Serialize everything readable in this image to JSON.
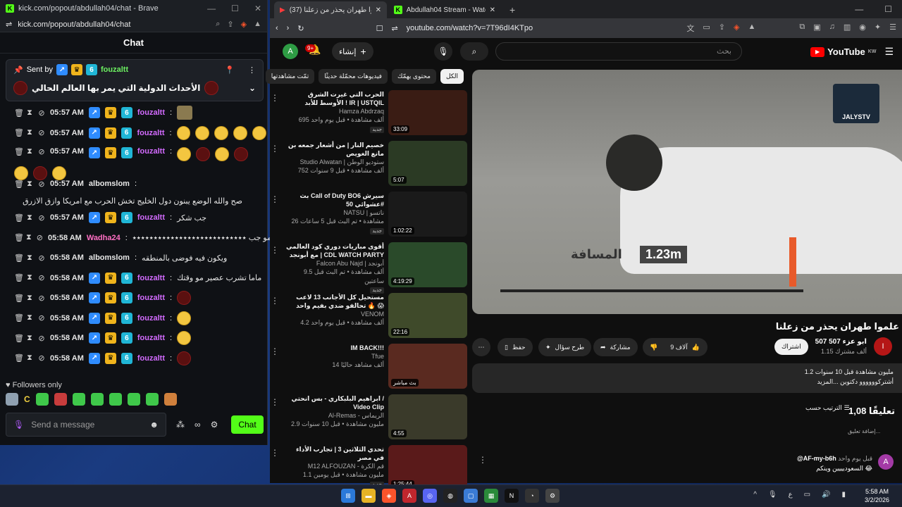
{
  "kick": {
    "window_title": "kick.com/popout/abdullah04/chat - Brave",
    "url": "kick.com/popout/abdullah04/chat",
    "chat_header": "Chat",
    "pinned": {
      "sent_by_label": "Sent by",
      "user": "fouzaltt",
      "message": "الأحداث الدولية التي يمر بها العالم الحالي"
    },
    "messages": [
      {
        "time": "05:57 AM",
        "user": "fouzaltt",
        "text": "",
        "emotes": 1
      },
      {
        "time": "05:57 AM",
        "user": "fouzaltt",
        "text": "",
        "emotes": 5
      },
      {
        "time": "05:57 AM",
        "user": "fouzaltt",
        "text": "",
        "emotes": 7
      },
      {
        "time": "05:57 AM",
        "user": "albomslom",
        "text": "صح والله الوضع يبنون دول الخليج تخش الحرب مع امريكا وازق الازرق"
      },
      {
        "time": "05:57 AM",
        "user": "fouzaltt",
        "text": "جب شكر"
      },
      {
        "time": "05:58 AM",
        "user": "Wadha24",
        "text": "مو جب ٭٭٭٭٭٭٭٭٭٭٭٭٭٭٭٭٭٭٭٭٭٭٭٭٭٭٭"
      },
      {
        "time": "05:58 AM",
        "user": "albomslom",
        "text": "ويكون فيه فوضى بالمنطقه"
      },
      {
        "time": "05:58 AM",
        "user": "fouzaltt",
        "text": "ماما تشرب عصير مو وقتك"
      },
      {
        "time": "05:58 AM",
        "user": "fouzaltt",
        "text": "",
        "emotes": 1
      },
      {
        "time": "05:58 AM",
        "user": "fouzaltt",
        "text": "",
        "emotes": 1
      },
      {
        "time": "05:58 AM",
        "user": "fouzaltt",
        "text": "",
        "emotes": 1
      },
      {
        "time": "05:58 AM",
        "user": "fouzaltt",
        "text": "",
        "emotes": 1
      }
    ],
    "followers_only": "Followers only",
    "input_placeholder": "Send a message",
    "send_label": "Chat"
  },
  "browser": {
    "tabs": [
      {
        "label": "(37) علموا طهران يحذر من زعلنا -"
      },
      {
        "label": "Abdullah04 Stream - Watch Live on K"
      }
    ],
    "url": "youtube.com/watch?v=7T96dI4KTpo"
  },
  "youtube": {
    "logo": "YouTube",
    "region": "KW",
    "search_placeholder": "بحث",
    "create_label": "إنشاء",
    "notifications": "9+",
    "avatar_letter": "A",
    "chips": [
      "الكل",
      "محتوى يهمّك",
      "فيديوهات محمّلة حديثًا",
      "تمّت مشاهدتها"
    ],
    "recs": [
      {
        "title": "الحرب التي غيرت الشرق الأوسط للأبد ! IR | USTQIL",
        "channel": "Hamza Abdrzaq",
        "stats": "695 ألف مشاهدة • قبل يوم واحد",
        "badge": "جديد",
        "duration": "33:09",
        "color": "#3a1c14"
      },
      {
        "title": "خصيم النار | من أشعار جمعه بن مانع الغويص",
        "channel": "Studio Alwatan | ستوديو الوطن",
        "stats": "752 ألف مشاهدة • قبل 9 سنوات",
        "badge": "",
        "duration": "5:07",
        "color": "#2b3a24"
      },
      {
        "title": "بث Call of Duty BO6 سيرش عشوائي 50#",
        "channel": "NATSU | ناتسو",
        "stats": "26 مشاهدة • تم البث قبل 5 ساعات",
        "badge": "جديد",
        "duration": "1:02:22",
        "color": "#1a1a1a"
      },
      {
        "title": "أقوى مباريات دوري كود العالمي مع أبونجد | CDL WATCH PARTY",
        "channel": "Falcon Abu Najd | أبونجد",
        "stats": "9.5 ألف مشاهدة • تم البث قبل ساعتين",
        "badge": "جديد",
        "duration": "4:19:29",
        "color": "#2a4a2a"
      },
      {
        "title": "مستحيل كل الأجانب 13 لاعب تحالفو ضدي بفيم واحد 🔥 😱",
        "channel": "VENOM",
        "stats": "4.2 ألف مشاهدة • قبل يوم واحد",
        "badge": "",
        "duration": "22:16",
        "color": "#3f4a2a"
      },
      {
        "title": "IM BACK!!!",
        "channel": "Tfue",
        "stats": "14 ألف مشاهد حاليًا",
        "badge": "",
        "duration": "بث مباشر",
        "color": "#5a2a20"
      },
      {
        "title": "ابراهيم البلبكاري - بس انحتي / Video Clip",
        "channel": "Al-Remas - الريماس",
        "stats": "2.9 مليون مشاهدة • قبل 10 سنوات",
        "badge": "",
        "duration": "4:55",
        "color": "#3a3a2a"
      },
      {
        "title": "تحدي الثلاثين 3 | تجارب الأداء في مصر",
        "channel": "M12 ALFOUZAN - قم الكرة",
        "stats": "1.1 مليون مشاهدة • قبل يومين",
        "badge": "جديد",
        "duration": "1:25:44",
        "color": "#5a1a1a"
      }
    ],
    "video": {
      "title": "علموا طهران يحذر من زعلنا",
      "watermark": "JALYSTV",
      "distance": "1.23m",
      "distance_label": "المسافة"
    },
    "channel": {
      "name": "ابو عزء",
      "subs": "1.15 ألف مشترك",
      "count": "507 507",
      "subscribe": "اشتراك"
    },
    "actions": {
      "likes": "9 آلاف",
      "share": "مشاركة",
      "ask": "طرح سؤال",
      "save": "حفظ"
    },
    "description": {
      "line1": "1.2 مليون مشاهدة  قبل 10 سنوات",
      "line2": "أشتركوووووو دكتوين ...المزيد"
    },
    "comments": {
      "count": "1,08 تعليقًا",
      "sort": "الترتيب حسب",
      "add": "إضافة تعليق...",
      "first_user": "@AF-my-b6h",
      "first_time": "قبل يوم واحد",
      "first_text": "السعوديييين وينكم 😂"
    }
  },
  "taskbar": {
    "time": "5:58 AM",
    "date": "3/2/2026",
    "lang": "ع"
  }
}
